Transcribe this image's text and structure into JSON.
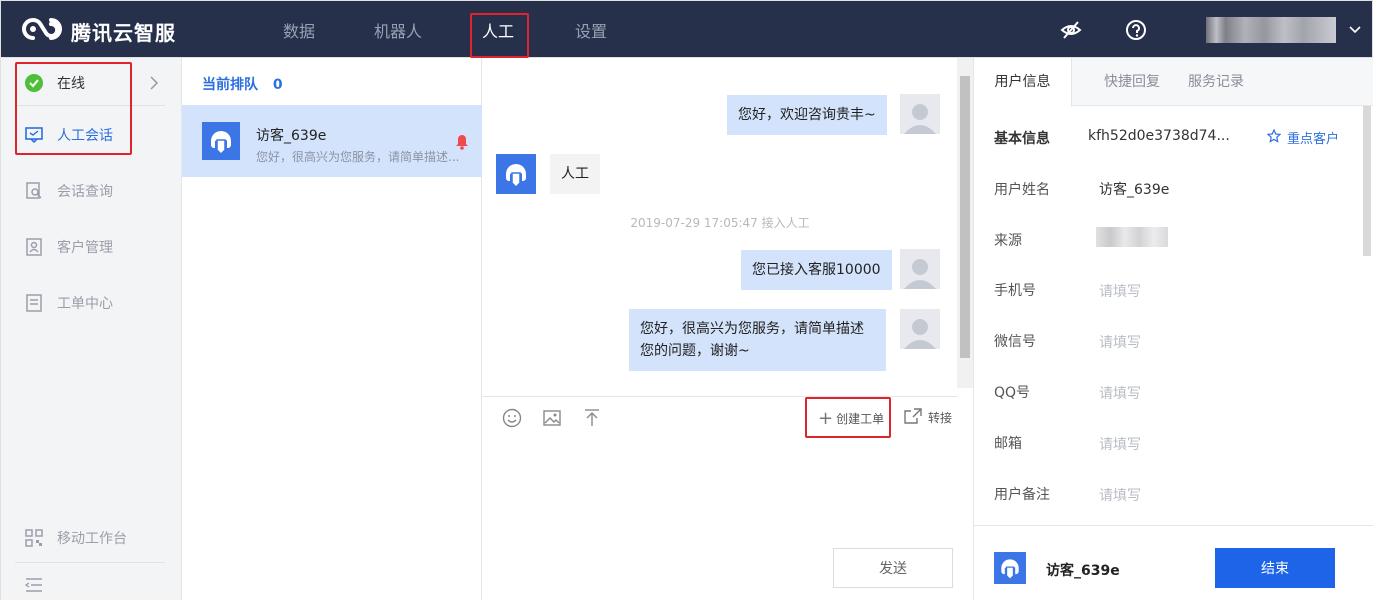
{
  "app": {
    "brand": "腾讯云智服"
  },
  "nav": {
    "items": [
      {
        "label": "数据"
      },
      {
        "label": "机器人"
      },
      {
        "label": "人工"
      },
      {
        "label": "设置"
      }
    ],
    "active": "人工"
  },
  "sidebar": {
    "status": "在线",
    "items": [
      {
        "label": "人工会话"
      },
      {
        "label": "会话查询"
      },
      {
        "label": "客户管理"
      },
      {
        "label": "工单中心"
      }
    ],
    "bottom": {
      "label": "移动工作台"
    }
  },
  "queue": {
    "title": "当前排队",
    "count": "0",
    "items": [
      {
        "name": "访客_639e",
        "preview": "您好，很高兴为您服务，请简单描述..."
      }
    ]
  },
  "chat": {
    "messages": [
      {
        "from": "agent",
        "text": "您好，欢迎咨询贵丰~"
      },
      {
        "from": "user",
        "text": "人工"
      },
      {
        "from": "system",
        "text": "2019-07-29 17:05:47 接入人工"
      },
      {
        "from": "agent",
        "text": "您已接入客服10000"
      },
      {
        "from": "agent",
        "text": "您好，很高兴为您服务，请简单描述您的问题，谢谢~"
      }
    ],
    "toolbar": {
      "create_ticket": "创建工单",
      "transfer": "转接"
    },
    "send_label": "发送"
  },
  "info": {
    "tabs": [
      {
        "label": "用户信息"
      },
      {
        "label": "快捷回复"
      },
      {
        "label": "服务记录"
      }
    ],
    "basic_label": "基本信息",
    "basic_id": "kfh52d0e3738d74...",
    "vip_label": "重点客户",
    "fields": [
      {
        "label": "用户姓名",
        "value": "访客_639e"
      },
      {
        "label": "来源",
        "value": ""
      },
      {
        "label": "手机号",
        "placeholder": "请填写"
      },
      {
        "label": "微信号",
        "placeholder": "请填写"
      },
      {
        "label": "QQ号",
        "placeholder": "请填写"
      },
      {
        "label": "邮箱",
        "placeholder": "请填写"
      },
      {
        "label": "用户备注",
        "placeholder": "请填写"
      }
    ],
    "footer": {
      "name": "访客_639e",
      "end_label": "结束"
    }
  },
  "colors": {
    "topbar": "#27304b",
    "accent": "#1d64e8",
    "highlight": "#e0242e",
    "selected": "#d3e3fb"
  }
}
